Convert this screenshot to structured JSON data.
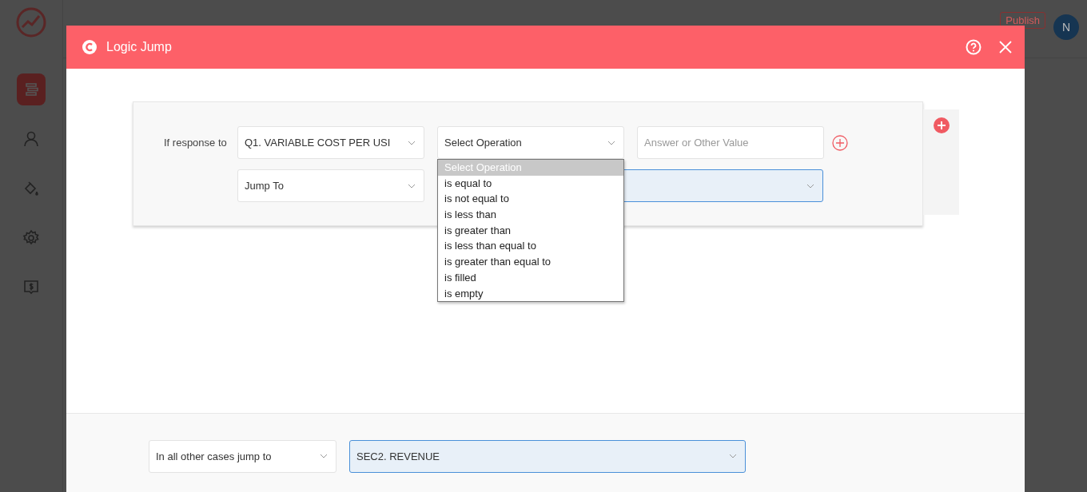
{
  "sidebar": {
    "items": [
      {
        "kind": "pages",
        "selected": true
      },
      {
        "kind": "user",
        "selected": false
      },
      {
        "kind": "paint",
        "selected": false
      },
      {
        "kind": "settings",
        "selected": false
      },
      {
        "kind": "pricing",
        "selected": false
      }
    ]
  },
  "topbar": {
    "publish": "Publish",
    "avatar": "N"
  },
  "modal": {
    "title": "Logic Jump",
    "rule": {
      "label": "If response to",
      "question": "Q1. VARIABLE COST PER USI",
      "operation": "Select Operation",
      "answer_placeholder": "Answer or Other Value",
      "jump": "Jump To",
      "dropdown": {
        "options": [
          {
            "label": "Select Operation",
            "selected": true
          },
          {
            "label": "is equal to",
            "selected": false
          },
          {
            "label": "is not equal to",
            "selected": false
          },
          {
            "label": "is less than",
            "selected": false
          },
          {
            "label": "is greater than",
            "selected": false
          },
          {
            "label": "is less than equal to",
            "selected": false
          },
          {
            "label": "is greater than equal to",
            "selected": false
          },
          {
            "label": "is filled",
            "selected": false
          },
          {
            "label": "is empty",
            "selected": false
          }
        ]
      }
    },
    "footer": {
      "label": "In all other cases jump to",
      "target": "SEC2. REVENUE"
    }
  }
}
